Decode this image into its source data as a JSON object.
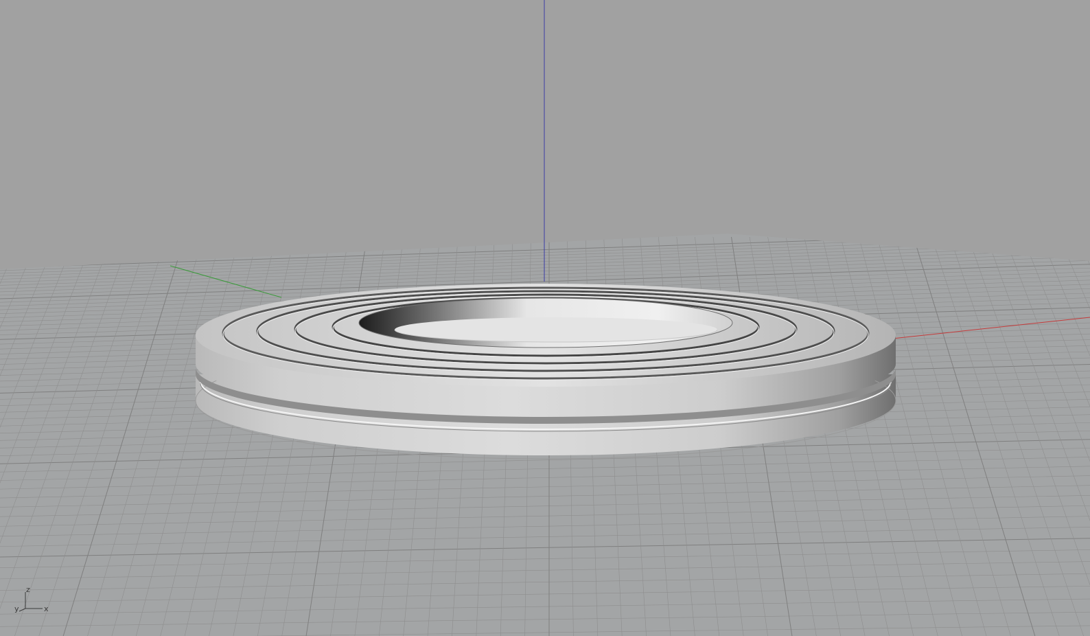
{
  "viewport": {
    "name": "Perspective",
    "background_color": "#a1a1a1",
    "grid_color": "#8e8e8e",
    "grid_major_color": "#7f7f7f"
  },
  "axes": {
    "x_color": "#c53a3a",
    "y_color": "#3a9a3a",
    "z_color": "#3a3aa5"
  },
  "axis_widget": {
    "x_label": "x",
    "y_label": "y",
    "z_label": "z"
  },
  "model": {
    "object": "stacked-ring-washer",
    "material_color": "#d6d6d6"
  }
}
